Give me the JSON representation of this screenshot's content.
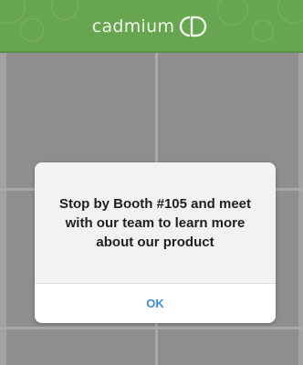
{
  "header": {
    "logo_text": "cadmium",
    "logo_mark_icon": "cd-monogram-icon",
    "background_color": "#68a550"
  },
  "dialog": {
    "message": "Stop by Booth #105 and meet with our team to learn more about our product",
    "ok_label": "OK",
    "ok_color": "#3a8fd1"
  },
  "overlay": {
    "dim_color": "#8c8c8c"
  }
}
